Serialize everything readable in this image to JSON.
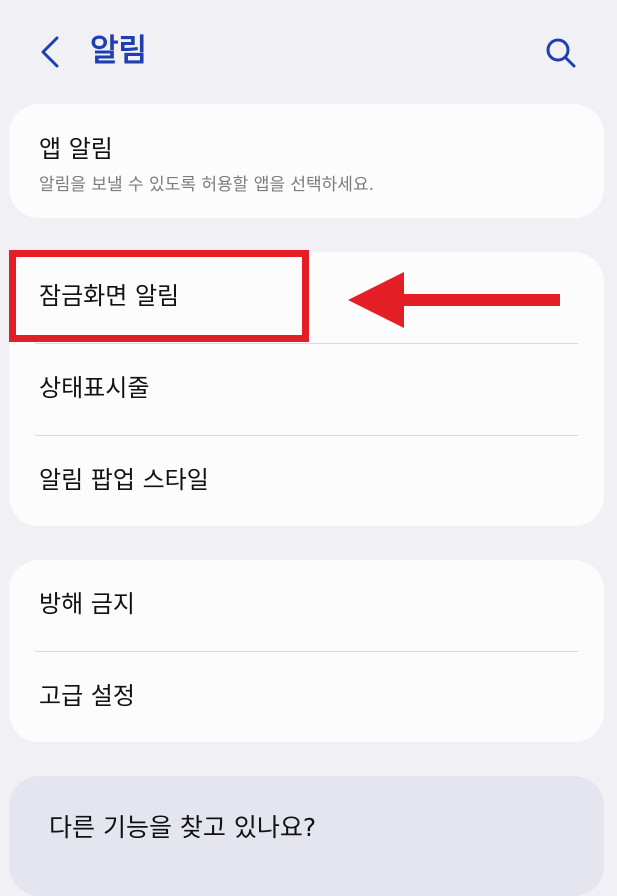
{
  "header": {
    "title": "알림",
    "back_icon": "chevron-left-icon",
    "search_icon": "search-icon"
  },
  "app_notifications": {
    "title": "앱 알림",
    "subtitle": "알림을 보낼 수 있도록 허용할 앱을 선택하세요."
  },
  "group1": {
    "items": [
      {
        "label": "잠금화면 알림"
      },
      {
        "label": "상태표시줄"
      },
      {
        "label": "알림 팝업 스타일"
      }
    ]
  },
  "group2": {
    "items": [
      {
        "label": "방해 금지"
      },
      {
        "label": "고급 설정"
      }
    ]
  },
  "more": {
    "title": "다른 기능을 찾고 있나요?"
  },
  "colors": {
    "accent": "#1e3fb0",
    "annotation": "#e31e24",
    "background": "#f1f1f5",
    "card": "#fcfcfd"
  }
}
